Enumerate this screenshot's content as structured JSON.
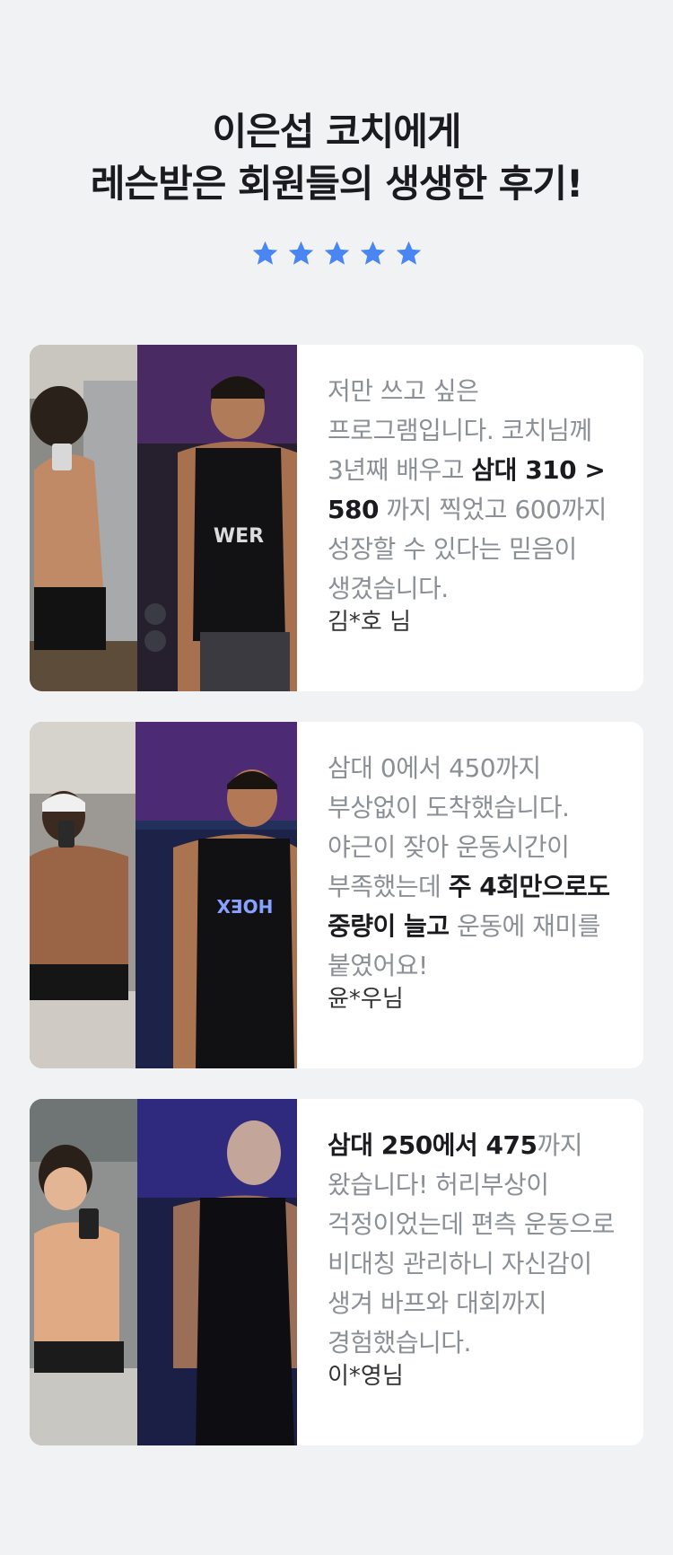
{
  "header": {
    "title_line1": "이은섭 코치에게",
    "title_line2": "레슨받은 회원들의 생생한 후기!",
    "rating": 5,
    "star_color": "#4a86f2"
  },
  "reviews": [
    {
      "parts": [
        {
          "t": "저만 쓰고 싶은 프로그램입니다. 코치님께 3년째 배우고 ",
          "b": false
        },
        {
          "t": "삼대 310 > 580",
          "b": true
        },
        {
          "t": " 까지 찍었고 600까지 성장할 수 있다는 믿음이 생겼습니다.",
          "b": false
        }
      ],
      "author": "김*호 님",
      "shirt_text": "WER"
    },
    {
      "parts": [
        {
          "t": "삼대 0에서 450까지 부상없이 도착했습니다. 야근이 잦아 운동시간이 부족했는데 ",
          "b": false
        },
        {
          "t": "주 4회만으로도 중량이 늘고",
          "b": true
        },
        {
          "t": " 운동에 재미를 붙였어요!",
          "b": false
        }
      ],
      "author": "윤*우님",
      "shirt_text": "HOEX"
    },
    {
      "parts": [
        {
          "t": "삼대 250에서 475",
          "b": true
        },
        {
          "t": "까지 왔습니다! 허리부상이 걱정이었는데 편측 운동으로 비대칭 관리하니 자신감이 생겨 바프와 대회까지 경험했습니다.",
          "b": false
        }
      ],
      "author": "이*영님",
      "shirt_text": ""
    }
  ]
}
